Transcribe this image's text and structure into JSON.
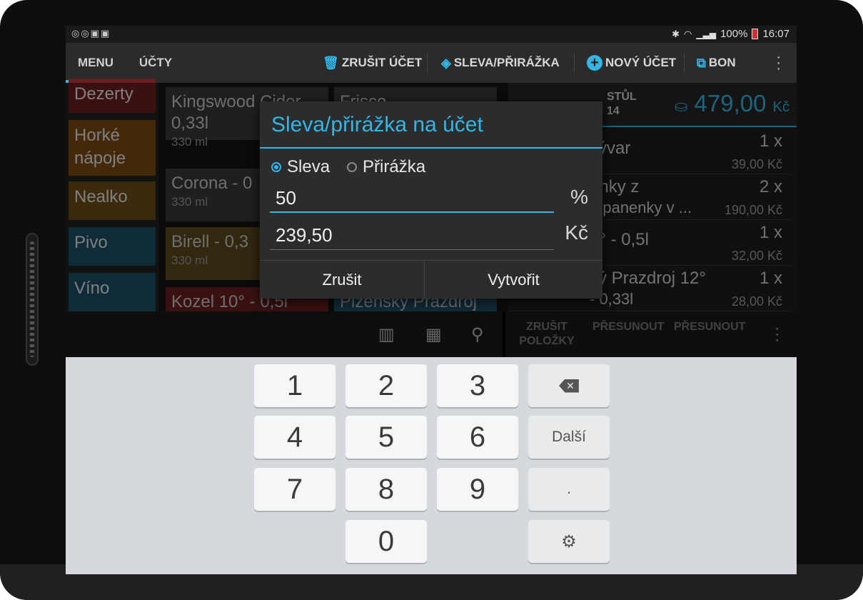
{
  "status_bar": {
    "left_icons": "◎◎▣▣",
    "battery": "100%",
    "time": "16:07"
  },
  "action_bar": {
    "tabs": [
      {
        "label": "MENU"
      },
      {
        "label": "ÚČTY"
      }
    ],
    "actions": {
      "cancel_account": "ZRUŠIT ÚČET",
      "discount": "SLEVA/PŘIRÁŽKA",
      "new_account": "NOVÝ ÚČET",
      "bon": "BON"
    }
  },
  "categories": [
    "Dezerty",
    "Horké nápoje",
    "Nealko",
    "Pivo",
    "Víno"
  ],
  "category_colors": [
    "#6a1e1e",
    "#7a4a12",
    "#6e4e16",
    "#1d4f66",
    "#1d4f66"
  ],
  "products": [
    {
      "name": "Kingswood Cider 0,33l",
      "size": "330 ml"
    },
    {
      "name": "Corona - 0",
      "size": "330 ml"
    },
    {
      "name": "Birell - 0,3",
      "size": "330 ml"
    },
    {
      "name": "Kozel 10° - 0,5l",
      "size": ""
    },
    {
      "name": "Frisco - ...",
      "size": ""
    },
    {
      "name": "Plzeňský Prazdroj",
      "size": ""
    }
  ],
  "order": {
    "table_label": "STŮL",
    "table_number": "14",
    "total": "479,00",
    "currency": "Kč",
    "items": [
      {
        "name": "vývar",
        "qty": "1 x",
        "price": "39,00 Kč"
      },
      {
        "name": "onky z",
        "name2": "é panenky v ...",
        "qty": "2 x",
        "price": "190,00 Kč"
      },
      {
        "name": "0° - 0,5l",
        "qty": "1 x",
        "price": "32,00 Kč"
      },
      {
        "name": "ký Prazdroj 12°",
        "name2": "- 0,33l",
        "qty": "1 x",
        "price": "28,00 Kč"
      }
    ]
  },
  "bottom_bar": {
    "cancel_items": "ZRUŠIT POLOŽKY",
    "move_out_1": "PŘESUNOUT",
    "move_out_2": "PŘESUNOUT"
  },
  "dialog": {
    "title": "Sleva/přirážka na účet",
    "option_discount": "Sleva",
    "option_surcharge": "Přirážka",
    "selected": "Sleva",
    "percent_value": "50",
    "percent_unit": "%",
    "amount_value": "239,50",
    "amount_unit": "Kč",
    "cancel_label": "Zrušit",
    "create_label": "Vytvořit"
  },
  "keyboard": {
    "keys": [
      "1",
      "2",
      "3",
      "4",
      "5",
      "6",
      "7",
      "8",
      "9",
      "0"
    ],
    "next_label": "Další",
    "dot_label": "."
  },
  "colors": {
    "accent": "#33b5e5",
    "keyboard_bg": "#d5d8dc"
  }
}
